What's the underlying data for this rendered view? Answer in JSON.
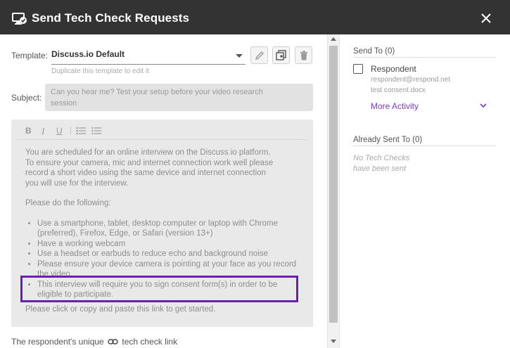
{
  "dialog": {
    "title": "Send Tech Check Requests"
  },
  "template": {
    "label": "Template:",
    "value": "Discuss.io Default",
    "hint": "Duplicate this template to edit it"
  },
  "subject": {
    "label": "Subject:",
    "value_line1": "Can you hear me? Test your setup before your video research",
    "value_line2": "session"
  },
  "editor": {
    "toolbar": {
      "bold": "B",
      "italic": "I",
      "underline": "U"
    },
    "intro": [
      "You are scheduled for an online interview on the Discuss.io platform.",
      "To ensure your camera, mic and internet connection work well please",
      "record a short video using the same device and internet connection",
      "you will use for the interview."
    ],
    "do_following": "Please do the following:",
    "bullets": [
      "Use a smartphone, tablet, desktop computer or laptop with Chrome (preferred), Firefox, Edge, or Safari (version 13+)",
      "Have a working webcam",
      "Use a headset or earbuds to reduce echo and background noise",
      "Please ensure your device camera is pointing at your face as you record the video.",
      "This interview will require you to sign consent form(s) in order to be eligible to participate."
    ],
    "closing": "Please click or copy and paste this link to get started."
  },
  "footer": {
    "text_before": "The respondent's unique",
    "text_after": "tech check link"
  },
  "send_to": {
    "title": "Send To (0)",
    "respondent_label": "Respondent",
    "email": "respondent@respond.net",
    "file": "test consent.docx",
    "more_activity": "More Activity"
  },
  "already_sent": {
    "title": "Already Sent To (0)",
    "empty_line1": "No Tech Checks",
    "empty_line2": "have been sent"
  },
  "colors": {
    "accent": "#7b3dbf",
    "highlight_border": "#6a1fb0",
    "titlebar": "#333333"
  }
}
